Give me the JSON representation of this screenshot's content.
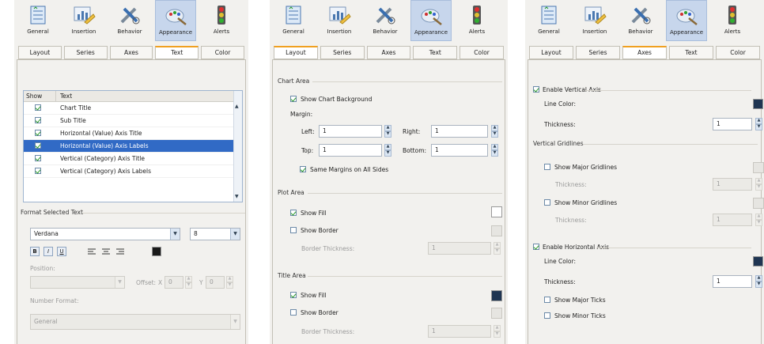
{
  "toolbar": {
    "general": "General",
    "insertion": "Insertion",
    "behavior": "Behavior",
    "appearance": "Appearance",
    "alerts": "Alerts"
  },
  "tabs": {
    "layout": "Layout",
    "series": "Series",
    "axes": "Axes",
    "text": "Text",
    "color": "Color"
  },
  "text_panel": {
    "col_show": "Show",
    "col_text": "Text",
    "rows": [
      {
        "label": "Chart Title",
        "checked": true
      },
      {
        "label": "Sub Title",
        "checked": true
      },
      {
        "label": "Horizontal (Value) Axis Title",
        "checked": true
      },
      {
        "label": "Horizontal (Value) Axis Labels",
        "checked": true
      },
      {
        "label": "Vertical (Category) Axis Title",
        "checked": true
      },
      {
        "label": "Vertical (Category) Axis Labels",
        "checked": true
      }
    ],
    "format_group": "Format Selected Text",
    "font": "Verdana",
    "size": "8",
    "bold": "B",
    "italic": "I",
    "underline": "U",
    "position_label": "Position:",
    "offset_label": "Offset:",
    "x_label": "X",
    "y_label": "Y",
    "offset_x": "0",
    "offset_y": "0",
    "number_format_label": "Number Format:",
    "number_format": "General"
  },
  "layout_panel": {
    "chart_area": "Chart Area",
    "show_chart_background": "Show Chart Background",
    "margin": "Margin:",
    "left": "Left:",
    "right": "Right:",
    "top": "Top:",
    "bottom": "Bottom:",
    "left_val": "1",
    "right_val": "1",
    "top_val": "1",
    "bottom_val": "1",
    "same_margins": "Same Margins on All Sides",
    "plot_area": "Plot Area",
    "show_fill": "Show Fill",
    "show_border": "Show Border",
    "border_thickness": "Border Thickness:",
    "plot_border_val": "1",
    "title_area": "Title Area",
    "title_show_fill": "Show Fill",
    "title_show_border": "Show Border",
    "title_border_thickness": "Border Thickness:",
    "title_border_val": "1"
  },
  "axes_panel": {
    "enable_vertical_axis": "Enable Vertical Axis",
    "line_color": "Line Color:",
    "thickness": "Thickness:",
    "v_thickness_val": "1",
    "vertical_gridlines": "Vertical Gridlines",
    "show_major_gridlines": "Show Major Gridlines",
    "major_thickness": "Thickness:",
    "major_val": "1",
    "show_minor_gridlines": "Show Minor Gridlines",
    "minor_thickness": "Thickness:",
    "minor_val": "1",
    "enable_horizontal_axis": "Enable Horizontal Axis",
    "h_line_color": "Line Color:",
    "h_thickness": "Thickness:",
    "h_thickness_val": "1",
    "show_major_ticks": "Show Major Ticks",
    "show_minor_ticks": "Show Minor Ticks"
  },
  "colors": {
    "active_tab_accent": "#f0a020",
    "selection": "#316ac5",
    "dark_swatch": "#1f3552"
  }
}
